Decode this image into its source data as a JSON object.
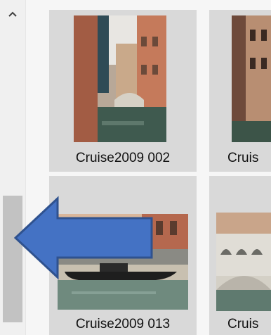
{
  "scrollbar": {
    "up_icon": "chevron-up-icon"
  },
  "tiles": [
    {
      "caption": "Cruise2009 002"
    },
    {
      "caption": "Cruis"
    },
    {
      "caption": "Cruise2009 013"
    },
    {
      "caption": "Cruis"
    }
  ],
  "annotation": {
    "arrow_icon": "left-arrow-icon",
    "fill": "#4472c4",
    "stroke": "#2f528f"
  }
}
